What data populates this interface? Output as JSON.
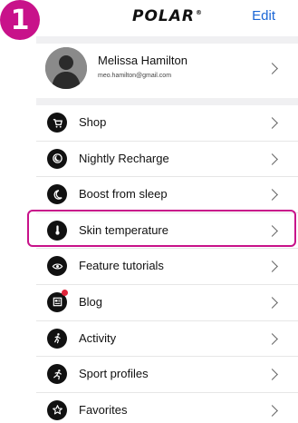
{
  "step_badge": "1",
  "header": {
    "logo_text": "POLAR",
    "logo_mark": "®",
    "edit_label": "Edit"
  },
  "profile": {
    "name": "Melissa Hamilton",
    "email": "meo.hamilton@gmail.com"
  },
  "menu": {
    "items": [
      {
        "label": "Shop",
        "icon": "shop-icon"
      },
      {
        "label": "Nightly Recharge",
        "icon": "nightly-recharge-icon"
      },
      {
        "label": "Boost from sleep",
        "icon": "moon-icon"
      },
      {
        "label": "Skin temperature",
        "icon": "thermometer-icon",
        "highlighted": true
      },
      {
        "label": "Feature tutorials",
        "icon": "tutorial-icon"
      },
      {
        "label": "Blog",
        "icon": "blog-icon",
        "notification_dot": true
      },
      {
        "label": "Activity",
        "icon": "activity-icon"
      },
      {
        "label": "Sport profiles",
        "icon": "sport-profiles-icon"
      },
      {
        "label": "Favorites",
        "icon": "star-icon"
      }
    ]
  },
  "colors": {
    "accent_magenta": "#c8128a",
    "link_blue": "#1a66d6",
    "notification_red": "#e0253a"
  }
}
